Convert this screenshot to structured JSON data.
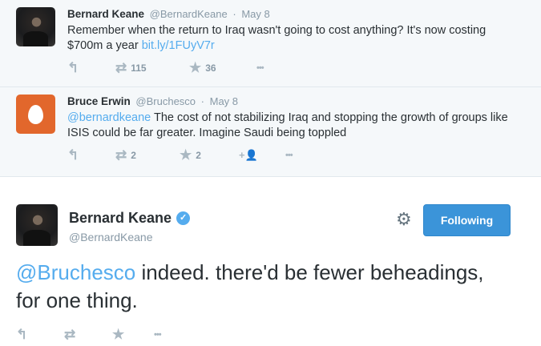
{
  "tweets": [
    {
      "name": "Bernard Keane",
      "handle": "@BernardKeane",
      "sep": "·",
      "date": "May 8",
      "text": "Remember when the return to Iraq wasn't going to cost anything? It's now costing $700m a year ",
      "link": "bit.ly/1FUyV7r",
      "retweets": "115",
      "favorites": "36"
    },
    {
      "name": "Bruce Erwin",
      "handle": "@Bruchesco",
      "sep": "·",
      "date": "May 8",
      "mention": "@bernardkeane",
      "text": " The cost of not stabilizing Iraq and stopping the growth of groups like ISIS could be far greater. Imagine Saudi being toppled",
      "retweets": "2",
      "favorites": "2"
    }
  ],
  "main": {
    "name": "Bernard Keane",
    "handle": "@BernardKeane",
    "follow_label": "Following",
    "mention": "@Bruchesco",
    "text": " indeed. there'd be fewer beheadings, for one thing."
  },
  "icons": {
    "reply": "↰",
    "retweet": "⇄",
    "favorite": "★",
    "more": "•••",
    "follow_user": "+👤",
    "gear": "⚙",
    "verified": "✓"
  },
  "colors": {
    "link": "#55acee",
    "follow_button": "#3b94d9",
    "egg_avatar": "#e2672c"
  }
}
